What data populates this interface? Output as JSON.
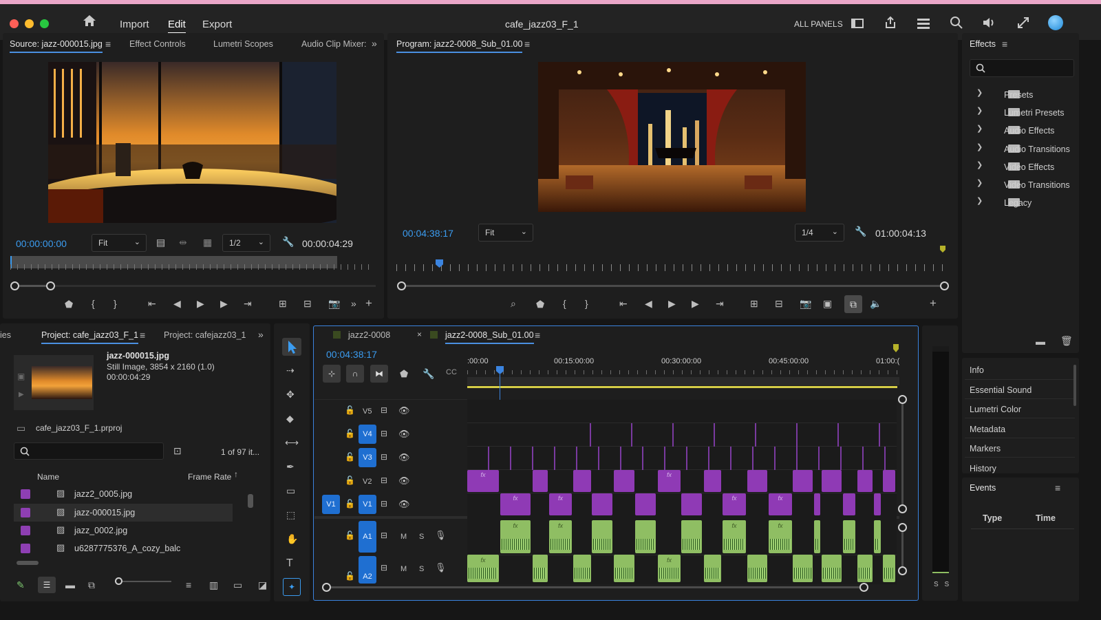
{
  "app": {
    "title": "cafe_jazz03_F_1",
    "menu": [
      "Import",
      "Edit",
      "Export"
    ],
    "active_menu": "Edit",
    "workspace": "ALL PANELS"
  },
  "source": {
    "tabs": [
      "Source: jazz-000015.jpg",
      "Effect Controls",
      "Lumetri Scopes",
      "Audio Clip Mixer:"
    ],
    "timecode_in": "00:00:00:00",
    "fit": "Fit",
    "resolution": "1/2",
    "duration": "00:00:04:29"
  },
  "program": {
    "tab": "Program: jazz2-0008_Sub_01.00",
    "timecode": "00:04:38:17",
    "fit": "Fit",
    "resolution": "1/4",
    "duration": "01:00:04:13"
  },
  "effects": {
    "title": "Effects",
    "items": [
      "Presets",
      "Lumetri Presets",
      "Audio Effects",
      "Audio Transitions",
      "Video Effects",
      "Video Transitions",
      "Legacy"
    ]
  },
  "right_panels": [
    "Info",
    "Essential Sound",
    "Lumetri Color",
    "Metadata",
    "Markers",
    "History"
  ],
  "events": {
    "title": "Events",
    "col_type": "Type",
    "col_time": "Time"
  },
  "project": {
    "tab_partial": "ies",
    "tabs": [
      "Project: cafe_jazz03_F_1",
      "Project: cafejazz03_1"
    ],
    "preview_name": "jazz-000015.jpg",
    "preview_info": "Still Image, 3854 x 2160 (1.0)",
    "preview_duration": "00:00:04:29",
    "project_file": "cafe_jazz03_F_1.prproj",
    "item_count": "1 of 97 it...",
    "col_name": "Name",
    "col_rate": "Frame Rate",
    "files": [
      "jazz2_0005.jpg",
      "jazz-000015.jpg",
      "jazz_0002.jpg",
      "u6287775376_A_cozy_balc"
    ]
  },
  "timeline": {
    "tabs": [
      "jazz2-0008",
      "jazz2-0008_Sub_01.00"
    ],
    "timecode": "00:04:38:17",
    "ruler": [
      ":00:00",
      "00:15:00:00",
      "00:30:00:00",
      "00:45:00:00",
      "01:00:("
    ],
    "video_tracks": [
      "V5",
      "V4",
      "V3",
      "V2",
      "V1"
    ],
    "audio_tracks": [
      "A1",
      "A2"
    ],
    "source_patch": "V1",
    "mute": "M",
    "solo": "S",
    "fx": "fx"
  },
  "meter": {
    "labels": "S S"
  },
  "colors": {
    "accent": "#3b9cf0",
    "video_clip": "#8f3ab5",
    "audio_clip": "#8fbe63",
    "track_target": "#1f6fd1"
  }
}
